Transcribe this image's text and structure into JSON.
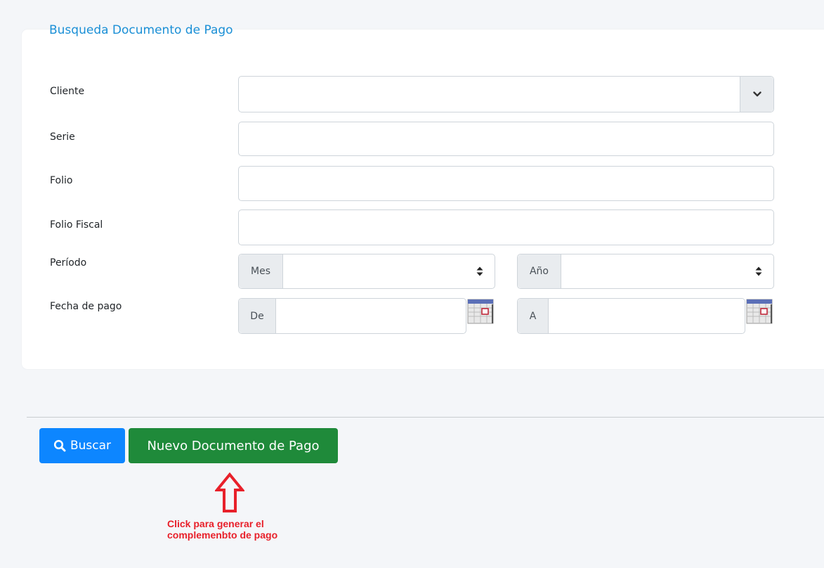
{
  "form": {
    "title": "Busqueda Documento de Pago",
    "labels": {
      "cliente": "Cliente",
      "serie": "Serie",
      "folio": "Folio",
      "folio_fiscal": "Folio Fiscal",
      "periodo": "Período",
      "fecha_pago": "Fecha de pago"
    },
    "fields": {
      "cliente_value": "",
      "serie_value": "",
      "folio_value": "",
      "folio_fiscal_value": "",
      "mes_value": "",
      "anio_value": "",
      "fecha_de_value": "",
      "fecha_a_value": ""
    },
    "addons": {
      "mes": "Mes",
      "anio": "Año",
      "de": "De",
      "a": "A"
    }
  },
  "actions": {
    "search_label": "Buscar",
    "new_label": "Nuevo Documento de Pago"
  },
  "annotation": {
    "text": "Click para generar el complemenbto de pago"
  },
  "colors": {
    "title": "#1a8fd6",
    "search_button": "#0d86ff",
    "new_button": "#1f8a3a",
    "annotation": "#e8202a"
  },
  "icons": {
    "cliente_dropdown": "chevron-down-icon",
    "sort": "sort-icon",
    "calendar": "calendar-icon",
    "search": "search-icon",
    "arrow": "arrow-up-icon"
  }
}
